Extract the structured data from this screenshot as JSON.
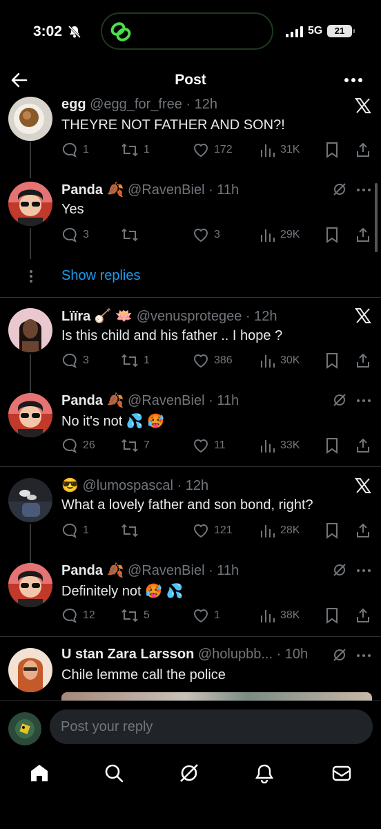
{
  "status_bar": {
    "time": "3:02",
    "network": "5G",
    "battery": "21"
  },
  "header": {
    "title": "Post"
  },
  "tweets": [
    {
      "name": "egg",
      "handle": "@egg_for_free · 12h",
      "text": "THEYRE NOT FATHER AND SON?!",
      "replies": "1",
      "reposts": "1",
      "likes": "172",
      "views": "31K"
    },
    {
      "name": "Panda 🍂",
      "handle": "@RavenBiel · 11h",
      "text": "Yes",
      "replies": "3",
      "reposts": "",
      "likes": "3",
      "views": "29K"
    },
    {
      "name": "Lïïra 🪕 🪷",
      "handle": "@venusprotegee · 12h",
      "text": "Is this child and his father .. I hope ?",
      "replies": "3",
      "reposts": "1",
      "likes": "386",
      "views": "30K"
    },
    {
      "name": "Panda 🍂",
      "handle": "@RavenBiel · 11h",
      "text": "No it's not 💦 🥵",
      "replies": "26",
      "reposts": "7",
      "likes": "11",
      "views": "33K"
    },
    {
      "name": "😎",
      "handle": "@lumospascal · 12h",
      "text": "What a lovely father and son bond, right?",
      "replies": "1",
      "reposts": "",
      "likes": "121",
      "views": "28K"
    },
    {
      "name": "Panda 🍂",
      "handle": "@RavenBiel · 11h",
      "text": "Definitely not 🥵 💦",
      "replies": "12",
      "reposts": "5",
      "likes": "1",
      "views": "38K"
    },
    {
      "name": "U stan Zara Larsson",
      "handle": "@holupbb... · 10h",
      "text": "Chile lemme call the police"
    }
  ],
  "show_replies": "Show replies",
  "reply_bar": {
    "placeholder": "Post your reply"
  },
  "colors": {
    "accent": "#1d9bf0",
    "muted": "#71767b",
    "text": "#e7e9ea",
    "background": "#000000"
  }
}
